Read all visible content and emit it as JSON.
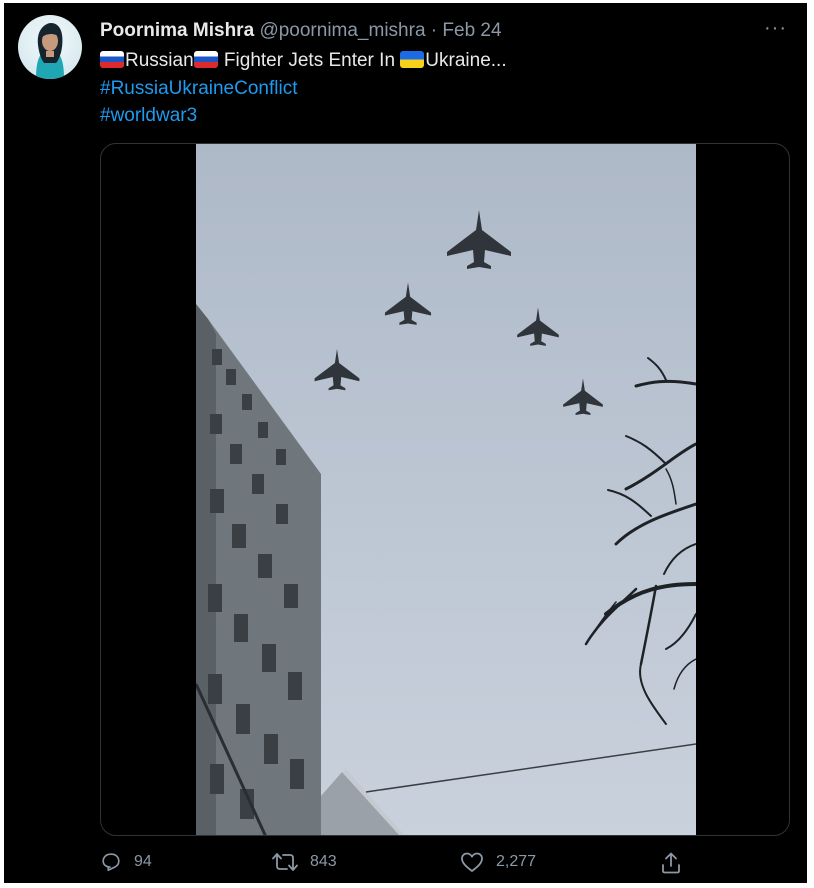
{
  "tweet": {
    "author": {
      "display_name": "Poornima Mishra",
      "handle": "@poornima_mishra",
      "separator": "·",
      "date": "Feb 24",
      "avatar_icon": "profile-photo"
    },
    "more_icon": "···",
    "text": {
      "flag1": "russia-flag",
      "word1": "Russian",
      "flag2": "russia-flag",
      "word2": " Fighter Jets Enter In ",
      "flag3": "ukraine-flag",
      "word3": "Ukraine..."
    },
    "hashtags": [
      "#RussiaUkraineConflict",
      "#worldwar3"
    ],
    "media": {
      "type": "video",
      "description_icon": "fighter-jets-formation"
    },
    "actions": {
      "reply_count": "94",
      "retweet_count": "843",
      "like_count": "2,277",
      "share_icon": "share-icon"
    }
  },
  "colors": {
    "background": "#000000",
    "text": "#e7e9ea",
    "muted": "#8b98a5",
    "link": "#1d9bf0",
    "sky": "#b8c4d3"
  }
}
